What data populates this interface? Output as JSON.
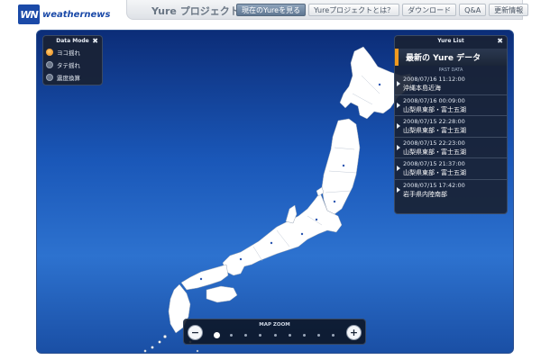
{
  "header": {
    "logo_mark": "WN",
    "logo_text": "weathernews",
    "app_title": "Yure プロジェクト",
    "nav": [
      {
        "label": "現在のYureを見る",
        "active": true
      },
      {
        "label": "Yureプロジェクトとは？",
        "active": false
      },
      {
        "label": "ダウンロード",
        "active": false
      },
      {
        "label": "Q&A",
        "active": false
      },
      {
        "label": "更新情報",
        "active": false
      }
    ]
  },
  "data_mode": {
    "title": "Data Mode",
    "close_glyph": "✖",
    "options": [
      {
        "label": "ヨコ揺れ",
        "selected": true
      },
      {
        "label": "タテ揺れ",
        "selected": false
      },
      {
        "label": "震度換算",
        "selected": false
      }
    ]
  },
  "yure_list": {
    "title": "Yure List",
    "close_glyph": "✖",
    "latest_label": "最新の Yure データ",
    "past_label": "PAST DATA",
    "entries": [
      {
        "date": "2008/07/16 11:12:00",
        "place": "沖縄本島近海"
      },
      {
        "date": "2008/07/16 00:09:00",
        "place": "山梨県東部・富士五湖"
      },
      {
        "date": "2008/07/15 22:28:00",
        "place": "山梨県東部・富士五湖"
      },
      {
        "date": "2008/07/15 22:23:00",
        "place": "山梨県東部・富士五湖"
      },
      {
        "date": "2008/07/15 21:37:00",
        "place": "山梨県東部・富士五湖"
      },
      {
        "date": "2008/07/15 17:42:00",
        "place": "岩手県内陸南部"
      }
    ]
  },
  "map_zoom": {
    "label": "MAP ZOOM",
    "zoom_out_glyph": "−",
    "zoom_in_glyph": "+",
    "levels": 9,
    "current_level": 1
  },
  "colors": {
    "accent": "#f29a1f",
    "brand": "#1b4aa8",
    "land": "#ffffff",
    "sea_top": "#0c2d78",
    "sea_bottom": "#2d72cf"
  }
}
